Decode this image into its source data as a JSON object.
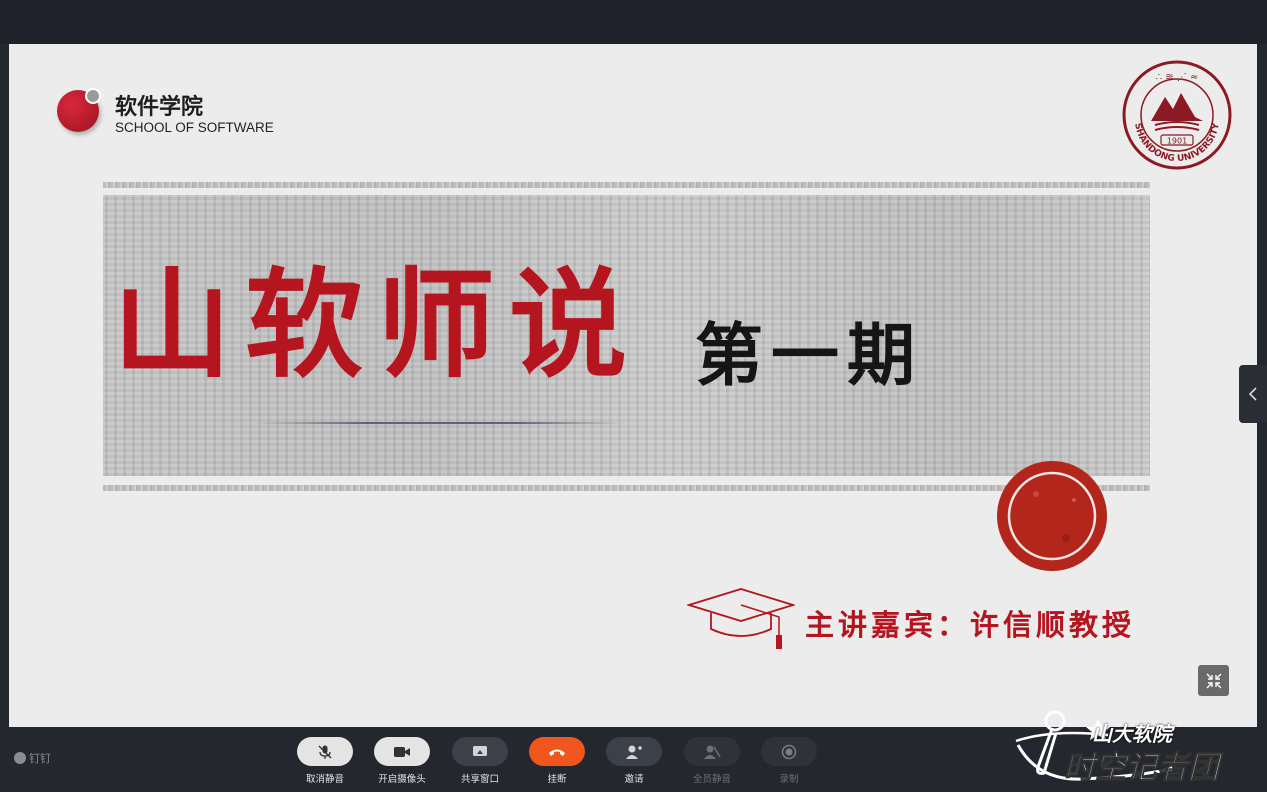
{
  "slide": {
    "logo_cn": "软件学院",
    "logo_en": "SCHOOL OF SOFTWARE",
    "seal_year": "1901",
    "seal_text": "SHANDONG UNIVERSITY",
    "title": "山软师说",
    "issue": "第一期",
    "speaker": "主讲嘉宾：许信顺教授"
  },
  "app_name": "钉钉",
  "controls": [
    {
      "label": "取消静音",
      "icon": "mic-icon",
      "state": "on"
    },
    {
      "label": "开启摄像头",
      "icon": "camera-icon",
      "state": "on"
    },
    {
      "label": "共享窗口",
      "icon": "screen-share-icon",
      "state": "mid"
    },
    {
      "label": "挂断",
      "icon": "hangup-icon",
      "state": "red"
    },
    {
      "label": "邀请",
      "icon": "invite-icon",
      "state": "mid"
    },
    {
      "label": "全员静音",
      "icon": "mute-all-icon",
      "state": "dim"
    },
    {
      "label": "录制",
      "icon": "record-icon",
      "state": "dim"
    }
  ],
  "watermark": {
    "line1": "山大软院",
    "line2": "时空记者团"
  },
  "colors": {
    "accent_red": "#b4151e",
    "hangup": "#f0561d",
    "toolbar_bg": "#24272d"
  }
}
